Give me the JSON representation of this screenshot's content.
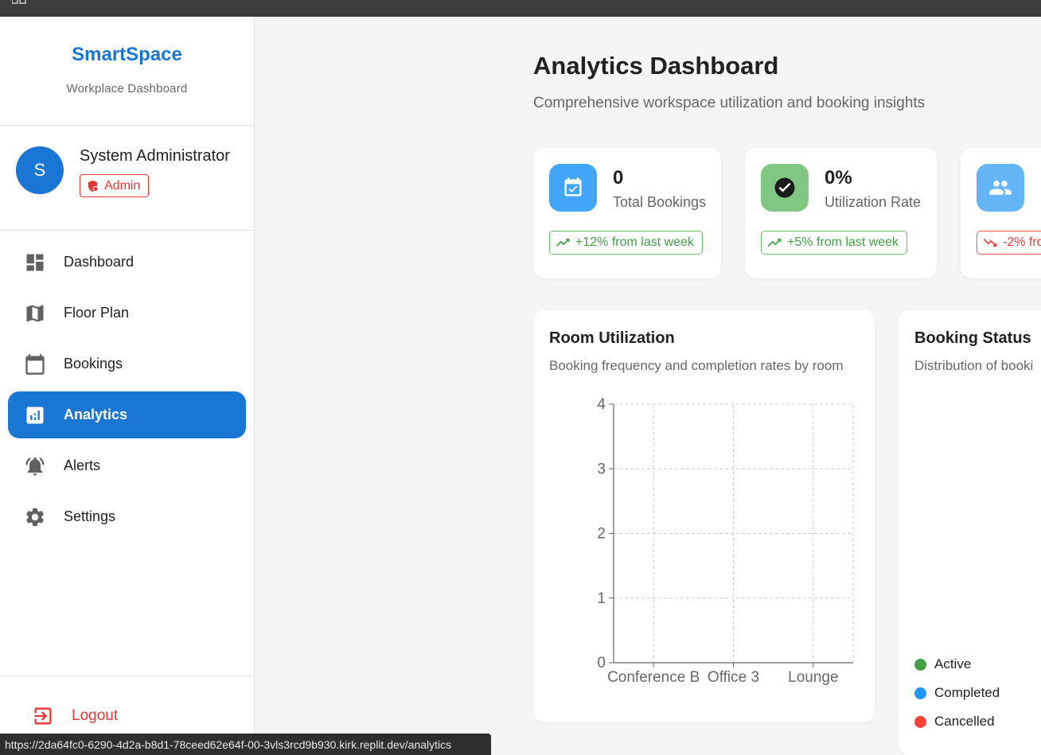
{
  "app": {
    "name": "SmartSpace",
    "subtitle": "Workplace Dashboard"
  },
  "user": {
    "initial": "S",
    "name": "System Administrator",
    "role": "Admin"
  },
  "nav": {
    "items": [
      {
        "label": "Dashboard",
        "icon": "dashboard-icon"
      },
      {
        "label": "Floor Plan",
        "icon": "map-icon"
      },
      {
        "label": "Bookings",
        "icon": "calendar-icon"
      },
      {
        "label": "Analytics",
        "icon": "analytics-icon",
        "active": true
      },
      {
        "label": "Alerts",
        "icon": "bell-icon"
      },
      {
        "label": "Settings",
        "icon": "gear-icon"
      }
    ],
    "logout_label": "Logout"
  },
  "page": {
    "title": "Analytics Dashboard",
    "subtitle": "Comprehensive workspace utilization and booking insights"
  },
  "stats": [
    {
      "value": "0",
      "label": "Total Bookings",
      "trend": "+12% from last week",
      "trend_dir": "up",
      "icon": "calendar-check-icon",
      "color": "#42a5f5"
    },
    {
      "value": "0%",
      "label": "Utilization Rate",
      "trend": "+5% from last week",
      "trend_dir": "up",
      "icon": "check-circle-icon",
      "color": "#81c784"
    },
    {
      "value": "",
      "label": "",
      "trend": "-2% fro",
      "trend_dir": "down",
      "icon": "people-icon",
      "color": "#64b5f6"
    }
  ],
  "room_utilization": {
    "title": "Room Utilization",
    "subtitle": "Booking frequency and completion rates by room"
  },
  "booking_status": {
    "title": "Booking Status",
    "subtitle": "Distribution of booki",
    "legend": [
      {
        "label": "Active",
        "color": "#43a047"
      },
      {
        "label": "Completed",
        "color": "#2196f3"
      },
      {
        "label": "Cancelled",
        "color": "#f44336"
      }
    ]
  },
  "chart_data": {
    "type": "bar",
    "categories": [
      "Conference B",
      "Office 3",
      "Lounge"
    ],
    "series": [],
    "title": "",
    "xlabel": "",
    "ylabel": "",
    "ylim": [
      0,
      4
    ],
    "yticks": [
      0,
      1,
      2,
      3,
      4
    ],
    "grid": true
  },
  "statusbar": {
    "url": "https://2da64fc0-6290-4d2a-b8d1-78ceed62e64f-00-3vls3rcd9b930.kirk.replit.dev/analytics"
  }
}
